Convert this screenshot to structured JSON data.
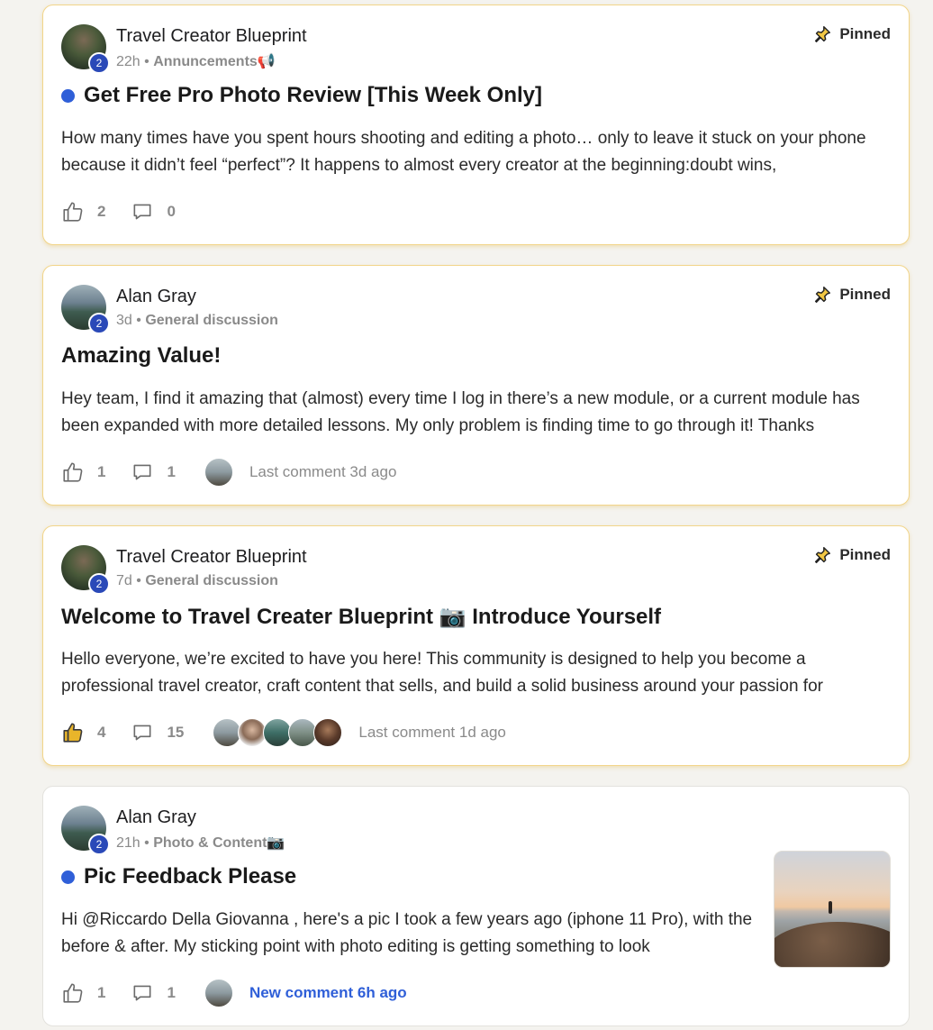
{
  "posts": [
    {
      "author": "Travel Creator Blueprint",
      "level": "2",
      "time": "22h",
      "separator": "•",
      "category": "Annuncements📢",
      "pinned_label": "Pinned",
      "title": "Get Free Pro Photo Review [This Week Only]",
      "unread": true,
      "body": "How many times have you spent hours shooting and editing a photo… only to leave it stuck on your phone because it didn’t feel “perfect”? It happens to almost every creator at the beginning:doubt wins,",
      "likes": "2",
      "comments": "0"
    },
    {
      "author": "Alan Gray",
      "level": "2",
      "time": "3d",
      "separator": "•",
      "category": "General discussion",
      "pinned_label": "Pinned",
      "title": "Amazing Value!",
      "unread": false,
      "body": "Hey team, I find it amazing that (almost) every time I log in there’s a new module, or a current module has been expanded with more detailed lessons. My only problem is finding time to go through it! Thanks",
      "likes": "1",
      "comments": "1",
      "last_comment": "Last comment 3d ago"
    },
    {
      "author": "Travel Creator Blueprint",
      "level": "2",
      "time": "7d",
      "separator": "•",
      "category": "General discussion",
      "pinned_label": "Pinned",
      "title": "Welcome to Travel Creater Blueprint 📷 Introduce Yourself",
      "unread": false,
      "body": "Hello everyone, we’re excited to have you here! This community is designed to help you become a professional travel creator, craft content that sells, and build a solid business around your passion for",
      "likes": "4",
      "comments": "15",
      "last_comment": "Last comment 1d ago"
    },
    {
      "author": "Alan Gray",
      "level": "2",
      "time": "21h",
      "separator": "•",
      "category": "Photo & Content📷",
      "title": "Pic Feedback Please",
      "unread": true,
      "body": "Hi @Riccardo Della Giovanna , here's a pic I took a few years ago (iphone 11 Pro), with the before & after. My sticking point with photo editing is getting something to look",
      "likes": "1",
      "comments": "1",
      "new_comment": "New comment 6h ago"
    }
  ],
  "colors": {
    "accent_blue": "#2f5fd8",
    "pinned_border": "#f2d58a",
    "liked_thumb": "#e9b52a"
  }
}
